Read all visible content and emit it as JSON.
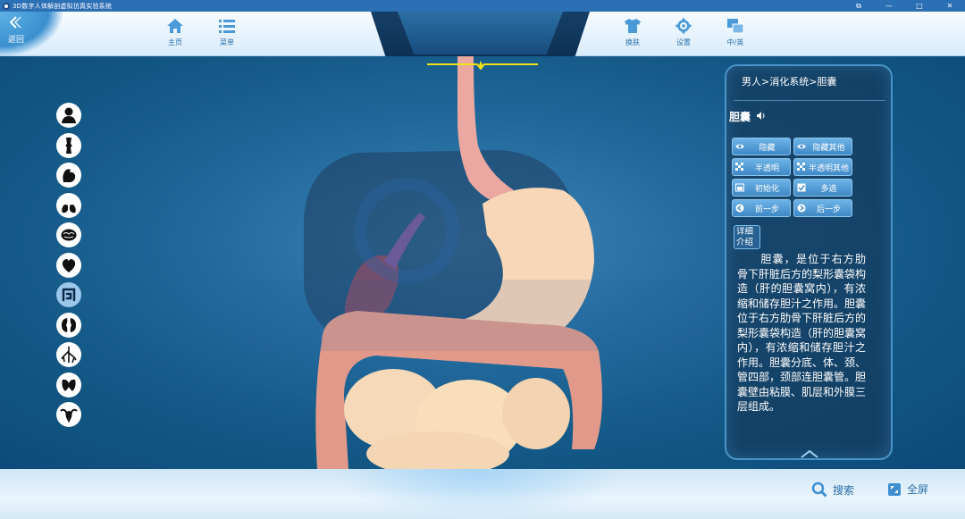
{
  "window": {
    "title": "3D数字人体解剖虚拟仿真实验系统",
    "controls": [
      "⧉",
      "—",
      "□",
      "✕"
    ]
  },
  "toolbar": {
    "back_label": "返回",
    "home_label": "主页",
    "menu_label": "菜单",
    "skin_label": "换肤",
    "settings_label": "设置",
    "language_label": "中/英"
  },
  "left_systems": [
    {
      "name": "body-outline-icon",
      "active": false
    },
    {
      "name": "skeleton-icon",
      "active": false
    },
    {
      "name": "muscle-icon",
      "active": false
    },
    {
      "name": "lungs-icon",
      "active": false
    },
    {
      "name": "brain-icon",
      "active": false
    },
    {
      "name": "heart-icon",
      "active": false
    },
    {
      "name": "intestine-icon",
      "active": true
    },
    {
      "name": "kidney-icon",
      "active": false
    },
    {
      "name": "vessels-icon",
      "active": false
    },
    {
      "name": "thyroid-icon",
      "active": false
    },
    {
      "name": "uterus-icon",
      "active": false
    }
  ],
  "panel": {
    "breadcrumb": "男人>消化系统>胆囊",
    "organ_name": "胆囊",
    "buttons": {
      "hide": "隐藏",
      "hide_others": "隐藏其他",
      "translucent": "半透明",
      "translucent_others": "半透明其他",
      "reset": "初始化",
      "multi_select": "多选",
      "prev": "前一步",
      "next": "后一步"
    },
    "detail_label": "详细介绍",
    "description": "胆囊，是位于右方肋骨下肝脏后方的梨形囊袋构造（肝的胆囊窝内），有浓缩和储存胆汁之作用。胆囊位于右方肋骨下肝脏后方的梨形囊袋构造（肝的胆囊窝内），有浓缩和储存胆汁之作用。胆囊分底、体、颈、管四部，颈部连胆囊管。胆囊壁由粘膜、肌层和外膜三层组成。"
  },
  "bottom": {
    "search_label": "搜索",
    "fullscreen_label": "全屏"
  },
  "colors": {
    "accent": "#2a6ea8",
    "panel_border": "#4b94c8",
    "button": "#4f9ad4",
    "guide_line": "#f2e21c"
  }
}
